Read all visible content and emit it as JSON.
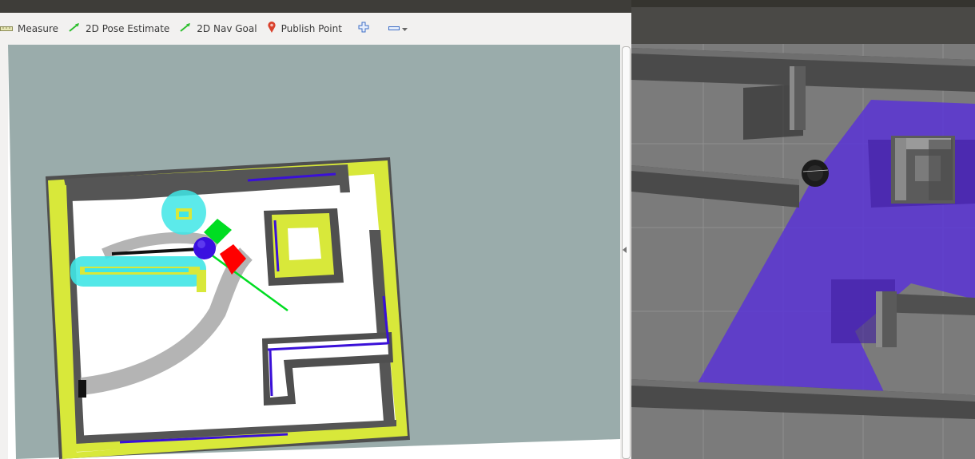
{
  "rviz": {
    "toolbar": {
      "measure": "Measure",
      "pose_estimate": "2D Pose Estimate",
      "nav_goal": "2D Nav Goal",
      "publish_point": "Publish Point"
    }
  },
  "icons": {
    "measure": "ruler-icon",
    "pose_estimate": "green-arrow-icon",
    "nav_goal": "green-arrow-icon",
    "publish_point": "map-pin-icon",
    "add": "plus-icon",
    "remove": "minus-icon",
    "more": "chevron-down-icon"
  },
  "colors": {
    "map_unknown": "#9aacab",
    "map_free": "#ffffff",
    "costmap_inflation": "#555555",
    "costmap_lethal": "#d8e83a",
    "laser": "#3a10d8",
    "robot_sphere": "#3a10e0",
    "axis_x": "#ff0000",
    "axis_y": "#00dd22",
    "path": "#00dd22",
    "gazebo_floor": "#7a7a7a",
    "gazebo_laser": "#6a3ed6"
  }
}
